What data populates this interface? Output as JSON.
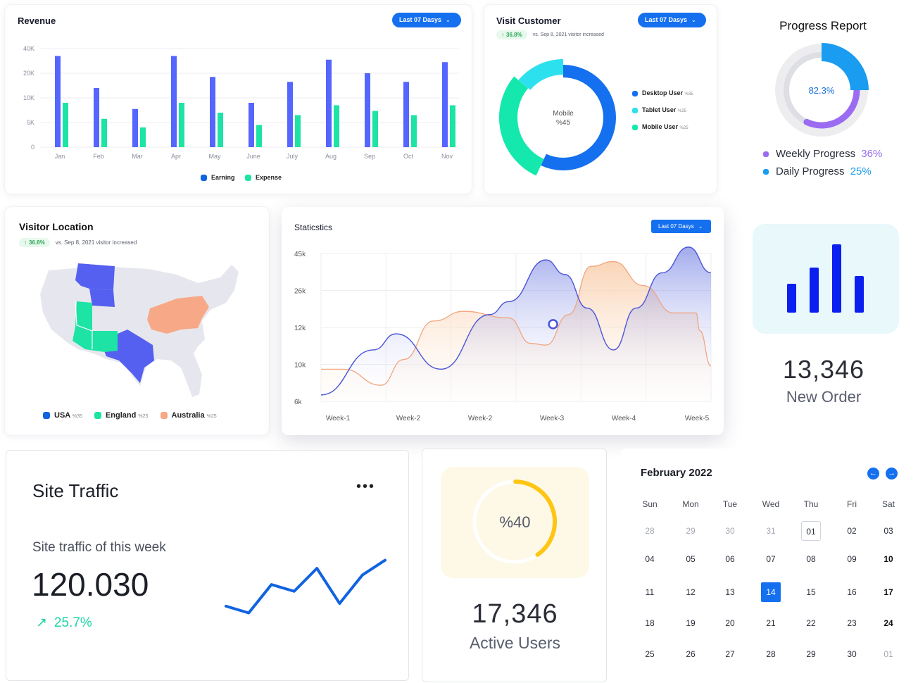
{
  "colors": {
    "primary": "#1570ef",
    "earning": "#5566ff",
    "expense": "#1de3a5",
    "desktop": "#1570ef",
    "tablet": "#2de0ee",
    "mobile": "#14e8ad",
    "weekly": "#9b6cf2",
    "daily": "#1a9df0",
    "australia": "#f7a987",
    "traffic_line": "#1163e0",
    "active_users": "#ffc513"
  },
  "revenue": {
    "title": "Revenue",
    "button": "Last 07 Dasys",
    "legend": [
      "Earning",
      "Expense"
    ],
    "chart_data": {
      "type": "bar",
      "categories": [
        "Jan",
        "Feb",
        "Mar",
        "Apr",
        "May",
        "June",
        "July",
        "Aug",
        "Sep",
        "Oct",
        "Nov"
      ],
      "series": [
        {
          "name": "Earning",
          "values": [
            37000,
            24000,
            15500,
            37000,
            28500,
            18000,
            26500,
            35500,
            30000,
            26500,
            34500
          ]
        },
        {
          "name": "Expense",
          "values": [
            18000,
            11500,
            8000,
            18000,
            14000,
            9000,
            13000,
            17000,
            14700,
            13000,
            17000
          ]
        }
      ],
      "yticks": [
        "0",
        "5K",
        "10K",
        "20K",
        "40K"
      ],
      "ylim": [
        0,
        40000
      ],
      "grid": true,
      "legend_position": "bottom"
    }
  },
  "visit_customer": {
    "title": "Visit Customer",
    "button": "Last 07 Dasys",
    "growth": "36.8%",
    "growth_note": "vs. Sep 8, 2021 visitor increased",
    "center_label": "Mobile",
    "center_value": "%45",
    "chart_data": {
      "type": "pie",
      "labels": [
        "Desktop User",
        "Tablet User",
        "Mobile User"
      ],
      "values": [
        35,
        25,
        45
      ],
      "value_labels": [
        "%35",
        "%25",
        "%25"
      ]
    }
  },
  "progress_report": {
    "title": "Progress Report",
    "center_value": "82.3%",
    "items": [
      {
        "label": "Weekly Progress",
        "value": "36%"
      },
      {
        "label": "Daily Progress",
        "value": "25%"
      }
    ],
    "chart_data": {
      "type": "pie",
      "labels": [
        "Daily Progress",
        "Weekly Progress"
      ],
      "values": [
        25,
        36
      ]
    }
  },
  "visitor_location": {
    "title": "Visitor Location",
    "growth": "36.8%",
    "growth_note": "vs. Sep 8, 2021 visitor increased",
    "legend": [
      {
        "label": "USA",
        "value": "%35"
      },
      {
        "label": "England",
        "value": "%25"
      },
      {
        "label": "Australia",
        "value": "%25"
      }
    ]
  },
  "statistics": {
    "title": "Staticstics",
    "button": "Last 07 Dasys",
    "chart_data": {
      "type": "area",
      "categories": [
        "Week-1",
        "Week-2",
        "Week-2",
        "Week-3",
        "Week-4",
        "Week-5"
      ],
      "yticks": [
        "6k",
        "10k",
        "12k",
        "26k",
        "45k"
      ],
      "y_scale": "categorical",
      "grid": true,
      "series": [
        {
          "points": [
            [
              0.0,
              0.2
            ],
            [
              0.7,
              1.6
            ],
            [
              1.0,
              2.1
            ],
            [
              1.6,
              1.0
            ],
            [
              2.25,
              2.7
            ],
            [
              2.5,
              3.1
            ],
            [
              3.0,
              4.4
            ],
            [
              3.25,
              3.95
            ],
            [
              3.55,
              2.9
            ],
            [
              3.9,
              1.6
            ],
            [
              4.2,
              2.9
            ],
            [
              4.55,
              4.0
            ],
            [
              4.9,
              4.8
            ],
            [
              5.2,
              4.0
            ]
          ]
        },
        {
          "points": [
            [
              0.0,
              1.0
            ],
            [
              0.3,
              1.0
            ],
            [
              0.8,
              0.5
            ],
            [
              1.1,
              1.3
            ],
            [
              1.5,
              2.5
            ],
            [
              1.9,
              2.8
            ],
            [
              2.5,
              2.6
            ],
            [
              2.8,
              1.8
            ],
            [
              3.0,
              1.75
            ],
            [
              3.3,
              2.7
            ],
            [
              3.6,
              4.2
            ],
            [
              3.9,
              4.35
            ],
            [
              4.3,
              3.6
            ],
            [
              4.7,
              2.75
            ],
            [
              5.0,
              2.75
            ],
            [
              5.05,
              2.2
            ],
            [
              5.2,
              1.1
            ]
          ]
        }
      ],
      "marker": {
        "x": 3.0,
        "y": 2.4
      }
    }
  },
  "new_order": {
    "value": "13,346",
    "label": "New Order",
    "chart_data": {
      "type": "bar",
      "values": [
        41,
        64,
        97,
        52
      ]
    }
  },
  "site_traffic": {
    "title": "Site Traffic",
    "menu": "•••",
    "subtitle": "Site traffic of this week",
    "value": "120.030",
    "growth": "25.7%",
    "chart_data": {
      "type": "line",
      "values": [
        22,
        12,
        54,
        44,
        78,
        26,
        68,
        90
      ]
    }
  },
  "active_users": {
    "gauge_label": "%40",
    "value": "17,346",
    "label": "Active Users",
    "chart_data": {
      "type": "pie",
      "values": [
        40
      ]
    }
  },
  "calendar": {
    "month": "February 2022",
    "weekdays": [
      "Sun",
      "Mon",
      "Tue",
      "Wed",
      "Thu",
      "Fri",
      "Sat"
    ],
    "weeks": [
      [
        "28",
        "29",
        "30",
        "31",
        "01",
        "02",
        "03"
      ],
      [
        "04",
        "05",
        "06",
        "07",
        "08",
        "09",
        "10"
      ],
      [
        "11",
        "12",
        "13",
        "14",
        "15",
        "16",
        "17"
      ],
      [
        "18",
        "19",
        "20",
        "21",
        "22",
        "23",
        "24"
      ],
      [
        "25",
        "26",
        "27",
        "28",
        "29",
        "30",
        "01"
      ]
    ],
    "today": "01",
    "selected": "14"
  }
}
